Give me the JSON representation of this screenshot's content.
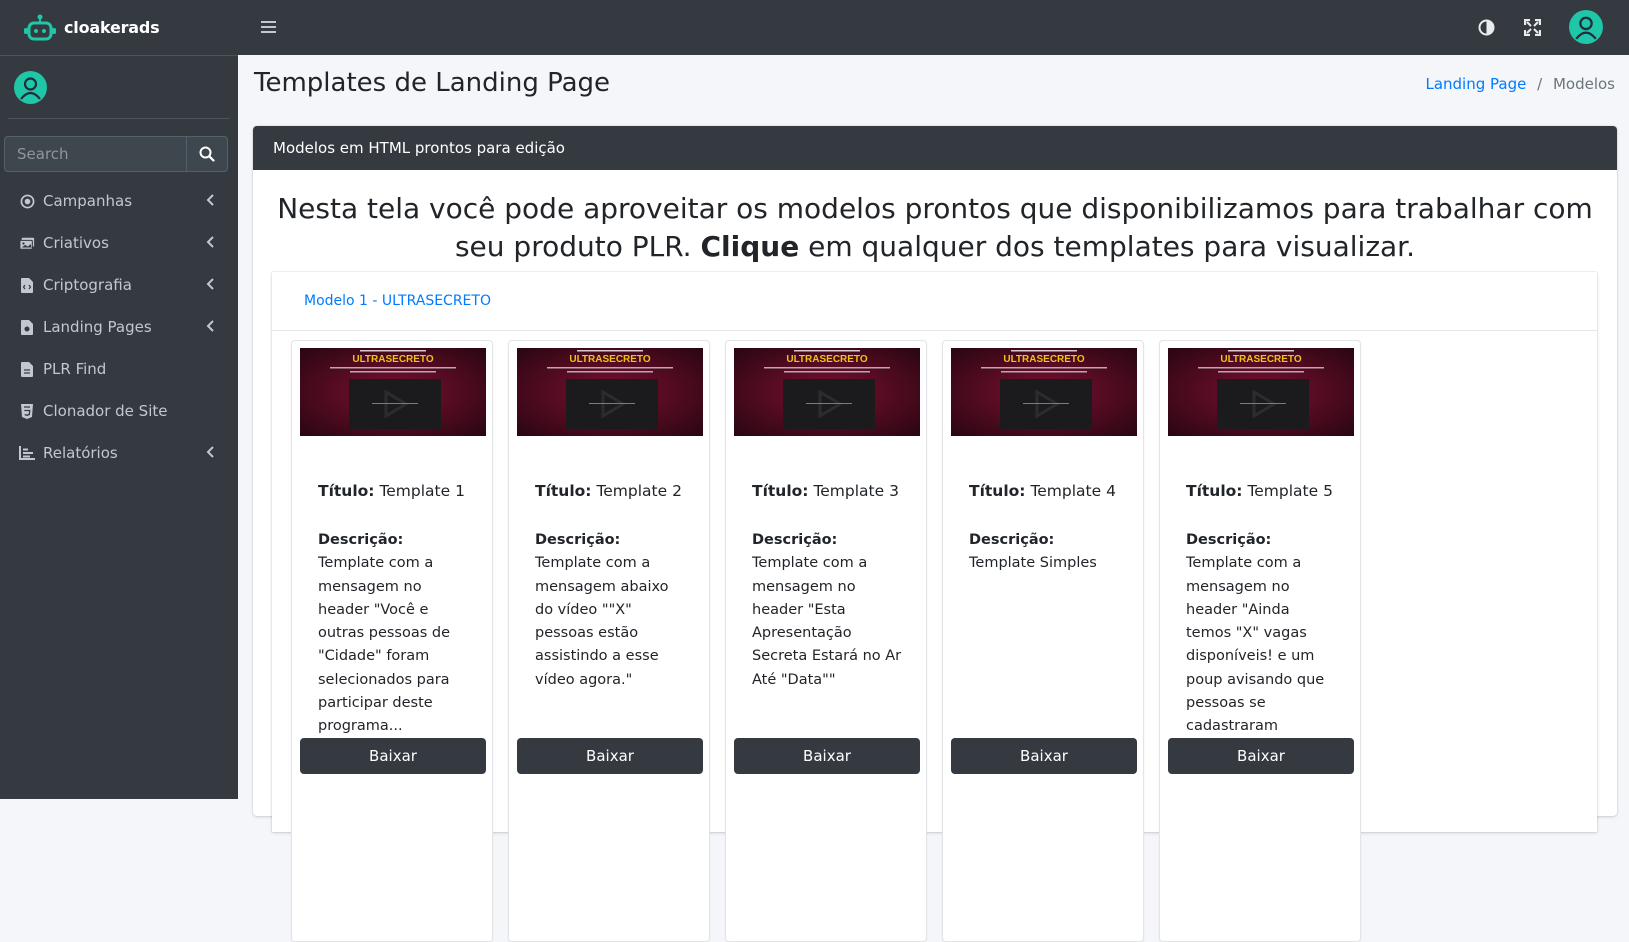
{
  "brand": {
    "name": "cloakerads"
  },
  "sidebar": {
    "search_placeholder": "Search",
    "items": [
      {
        "label": "Campanhas",
        "icon": "dot-circle-icon",
        "has_submenu": true
      },
      {
        "label": "Criativos",
        "icon": "images-icon",
        "has_submenu": true
      },
      {
        "label": "Criptografia",
        "icon": "file-code-icon",
        "has_submenu": true
      },
      {
        "label": "Landing Pages",
        "icon": "file-icon",
        "has_submenu": true
      },
      {
        "label": "PLR Find",
        "icon": "file-alt-icon",
        "has_submenu": false
      },
      {
        "label": "Clonador de Site",
        "icon": "html5-icon",
        "has_submenu": false
      },
      {
        "label": "Relatórios",
        "icon": "chart-icon",
        "has_submenu": true
      }
    ]
  },
  "page": {
    "title": "Templates de Landing Page",
    "breadcrumb": {
      "link": "Landing Page",
      "separator": "/",
      "current": "Modelos"
    }
  },
  "card": {
    "header": "Modelos em HTML prontos para edição",
    "intro_part1": "Nesta tela você pode aproveitar os modelos prontos que disponibilizamos para trabalhar com seu produto PLR.",
    "intro_bold": "Clique",
    "intro_part2": "em qualquer dos templates para visualizar."
  },
  "model": {
    "title": "Modelo 1 - ULTRASECRETO"
  },
  "templates": [
    {
      "title_label": "Título:",
      "title": "Template 1",
      "desc_label": "Descrição:",
      "desc": "Template com a mensagem no header \"Você e outras pessoas de \"Cidade\" foram selecionados para participar deste programa...",
      "button": "Baixar",
      "thumb_text": "ULTRASECRETO"
    },
    {
      "title_label": "Título:",
      "title": "Template 2",
      "desc_label": "Descrição:",
      "desc": "Template com a mensagem abaixo do vídeo \"\"X\" pessoas estão assistindo a esse vídeo agora.\"",
      "button": "Baixar",
      "thumb_text": "ULTRASECRETO"
    },
    {
      "title_label": "Título:",
      "title": "Template 3",
      "desc_label": "Descrição:",
      "desc": "Template com a mensagem no header \"Esta Apresentação Secreta Estará no Ar Até \"Data\"\"",
      "button": "Baixar",
      "thumb_text": "ULTRASECRETO"
    },
    {
      "title_label": "Título:",
      "title": "Template 4",
      "desc_label": "Descrição:",
      "desc": "Template Simples",
      "button": "Baixar",
      "thumb_text": "ULTRASECRETO"
    },
    {
      "title_label": "Título:",
      "title": "Template 5",
      "desc_label": "Descrição:",
      "desc": "Template com a mensagem no header \"Ainda temos \"X\" vagas disponíveis! e um poup avisando que pessoas se cadastraram segundos atrás\"",
      "button": "Baixar",
      "thumb_text": "ULTRASECRETO"
    }
  ],
  "colors": {
    "dark": "#343a40",
    "accent": "#007bff",
    "avatar": "#1fc6a7",
    "background": "#f4f6f9"
  }
}
